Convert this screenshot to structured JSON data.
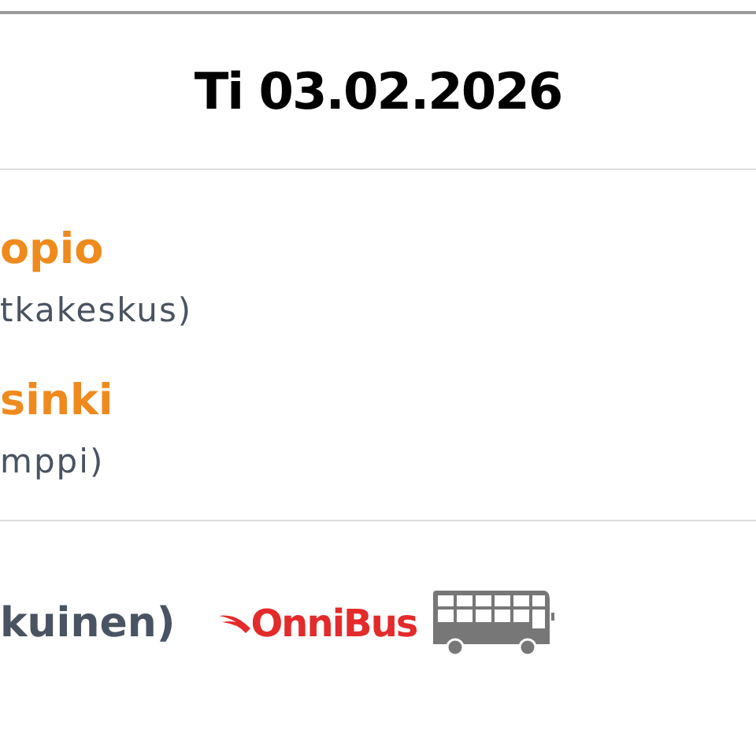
{
  "date": "Ti 03.02.2026",
  "stops": [
    {
      "city": "opio",
      "station": "tkakeskus)"
    },
    {
      "city": "sinki",
      "station": "mppi)"
    }
  ],
  "operator": {
    "ticket_type": "kuinen)",
    "brand": "OnniBus"
  }
}
